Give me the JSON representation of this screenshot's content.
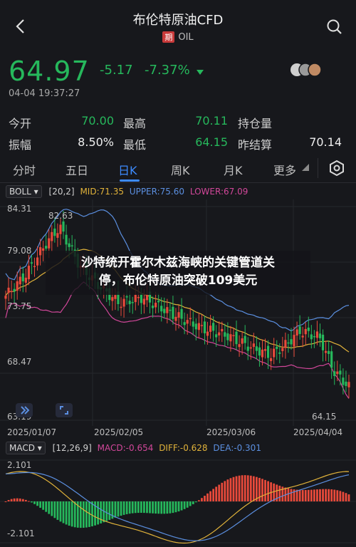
{
  "header": {
    "title": "布伦特原油CFD",
    "badge": "期",
    "symbol": "OIL"
  },
  "quote": {
    "price": "64.97",
    "change": "-5.17",
    "change_pct": "-7.37%",
    "timestamp": "04-04 19:37:27",
    "stats": {
      "open_label": "今开",
      "open": "70.00",
      "high_label": "最高",
      "high": "70.11",
      "oi_label": "持仓量",
      "oi": "",
      "amp_label": "振幅",
      "amp": "8.50%",
      "low_label": "最低",
      "low": "64.15",
      "prev_label": "昨结算",
      "prev": "70.14"
    }
  },
  "tabs": [
    "分时",
    "五日",
    "日K",
    "周K",
    "月K",
    "更多"
  ],
  "boll": {
    "name": "BOLL",
    "param": "[20,2]",
    "mid": "MID:71.35",
    "upper": "UPPER:75.60",
    "lower": "LOWER:67.09"
  },
  "price_axis": [
    "84.31",
    "79.08",
    "73.75",
    "68.47",
    "63.19"
  ],
  "annotations": {
    "max": "82.63",
    "min": "64.15"
  },
  "dates": [
    "2025/01/07",
    "2025/02/05",
    "2025/03/06",
    "2025/04/04"
  ],
  "macd": {
    "name": "MACD",
    "param": "[12,26,9]",
    "macd": "MACD:-0.654",
    "diff": "DIFF:-0.628",
    "dea": "DEA:-0.301",
    "axis_top": "2.101",
    "axis_bottom": "-2.101"
  },
  "headline": {
    "line1": "沙特统开霍尔木兹海峡的关键管道关",
    "line2": "停，布伦特原油突破109美元"
  },
  "icons": [
    "back-icon",
    "search-icon",
    "avatar-group-icon",
    "settings-icon",
    "collapse-icon",
    "fullscreen-icon"
  ],
  "colors": {
    "up": "#e84a3b",
    "down": "#26b85c",
    "accent": "#3d8bff",
    "mid": "#e0b23a",
    "upper": "#5b8fe0",
    "lower": "#d2479a"
  }
}
